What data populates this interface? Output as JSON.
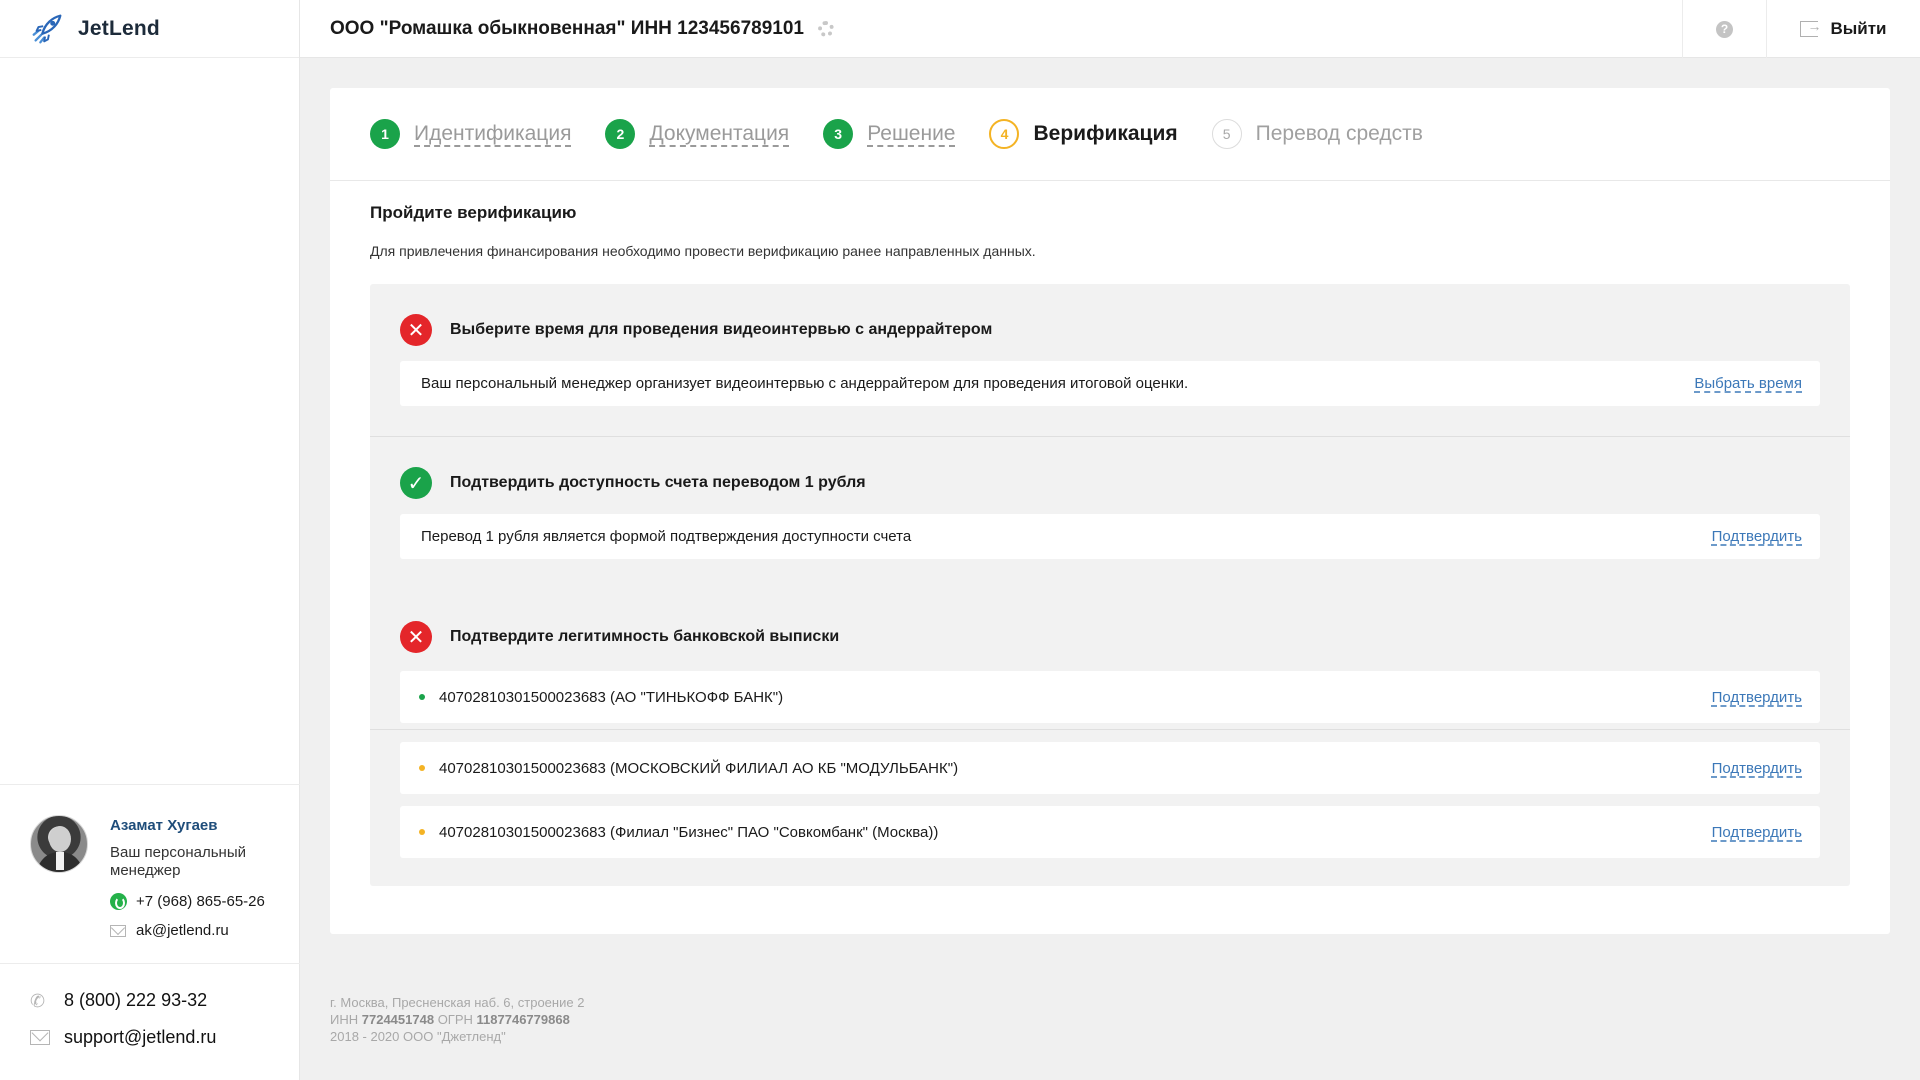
{
  "app": {
    "logo_text": "JetLend"
  },
  "header": {
    "company": "ООО \"Ромашка обыкновенная\" ИНН 123456789101",
    "logout_label": "Выйти",
    "help_glyph": "?"
  },
  "steps": [
    {
      "num": "1",
      "label": "Идентификация",
      "state": "done"
    },
    {
      "num": "2",
      "label": "Документация",
      "state": "done"
    },
    {
      "num": "3",
      "label": "Решение",
      "state": "done"
    },
    {
      "num": "4",
      "label": "Верификация",
      "state": "active"
    },
    {
      "num": "5",
      "label": "Перевод средств",
      "state": "todo"
    }
  ],
  "content": {
    "title": "Пройдите верификацию",
    "subtitle": "Для привлечения финансирования необходимо провести верификацию ранее направленных данных."
  },
  "sections": [
    {
      "status": "error",
      "title": "Выберите время для проведения видеоинтервью с андеррайтером",
      "text": "Ваш персональный менеджер организует видеоинтервью с андеррайтером для проведения итоговой оценки.",
      "action": "Выбрать время"
    },
    {
      "status": "ok",
      "title": "Подтвердить доступность счета переводом 1 рубля",
      "text": "Перевод 1 рубля является формой подтверждения доступности счета",
      "action": "Подтвердить"
    },
    {
      "status": "error",
      "title": "Подтвердите легитимность банковской выписки",
      "accounts": [
        {
          "text": "40702810301500023683 (АО \"ТИНЬКОФФ БАНК\")",
          "dot": "green",
          "action": "Подтвердить"
        },
        {
          "text": "40702810301500023683 (МОСКОВСКИЙ ФИЛИАЛ АО КБ \"МОДУЛЬБАНК\")",
          "dot": "orange",
          "action": "Подтвердить"
        },
        {
          "text": "40702810301500023683 (Филиал \"Бизнес\" ПАО \"Совкомбанк\" (Москва))",
          "dot": "orange",
          "action": "Подтвердить"
        }
      ]
    }
  ],
  "manager": {
    "name": "Азамат Хугаев",
    "role": "Ваш персональный менеджер",
    "phone": "+7 (968) 865-65-26",
    "email": "ak@jetlend.ru"
  },
  "support": {
    "phone": "8 (800) 222 93-32",
    "email": "support@jetlend.ru"
  },
  "footer": {
    "address": "г. Москва, Пресненская наб. 6, строение 2",
    "inn_label": "ИНН",
    "inn": "7724451748",
    "ogrn_label": "ОГРН",
    "ogrn": "1187746779868",
    "copyright": "2018 - 2020 ООО \"Джетленд\""
  },
  "colors": {
    "success": "#1aa34a",
    "error": "#e4262a",
    "warning": "#f4b324",
    "link": "#3c78b8",
    "brand_dark": "#1d2b3a"
  },
  "icons": {
    "logo": "rocket-icon",
    "settings": "gear-icon",
    "help": "help-icon",
    "logout": "logout-icon",
    "error": "cross-icon",
    "ok": "check-icon",
    "whatsapp": "whatsapp-icon",
    "mail": "mail-icon",
    "phone": "phone-icon"
  }
}
